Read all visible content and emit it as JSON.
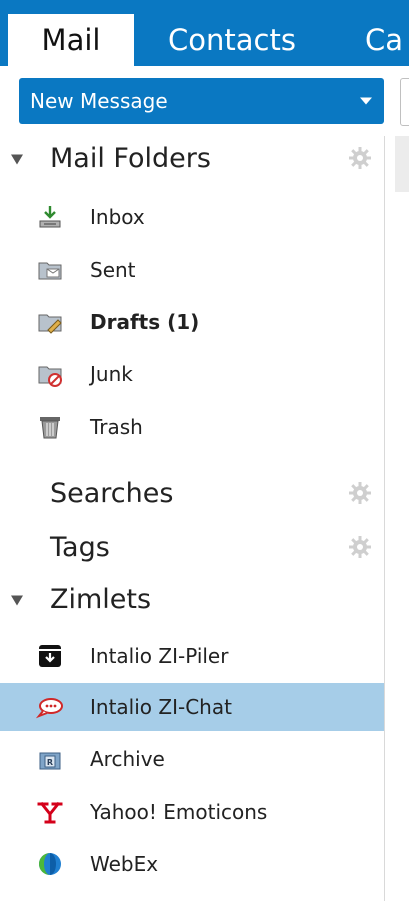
{
  "tabs": {
    "mail": "Mail",
    "contacts": "Contacts",
    "calendar": "Ca"
  },
  "new_message": {
    "label": "New Message"
  },
  "mail_folders": {
    "title": "Mail Folders",
    "items": [
      {
        "label": "Inbox",
        "icon": "inbox-icon"
      },
      {
        "label": "Sent",
        "icon": "sent-folder-icon"
      },
      {
        "label": "Drafts (1)",
        "icon": "drafts-folder-icon",
        "bold": true
      },
      {
        "label": "Junk",
        "icon": "junk-folder-icon"
      },
      {
        "label": "Trash",
        "icon": "trash-icon"
      }
    ]
  },
  "searches": {
    "title": "Searches"
  },
  "tags": {
    "title": "Tags"
  },
  "zimlets": {
    "title": "Zimlets",
    "items": [
      {
        "label": "Intalio ZI-Piler",
        "icon": "archive-box-icon"
      },
      {
        "label": "Intalio ZI-Chat",
        "icon": "chat-bubble-icon",
        "selected": true
      },
      {
        "label": "Archive",
        "icon": "archive-folder-icon"
      },
      {
        "label": "Yahoo! Emoticons",
        "icon": "yahoo-icon"
      },
      {
        "label": "WebEx",
        "icon": "webex-icon"
      }
    ]
  },
  "colors": {
    "brand_blue": "#0a78c2",
    "selected_row": "#a6cde8"
  }
}
